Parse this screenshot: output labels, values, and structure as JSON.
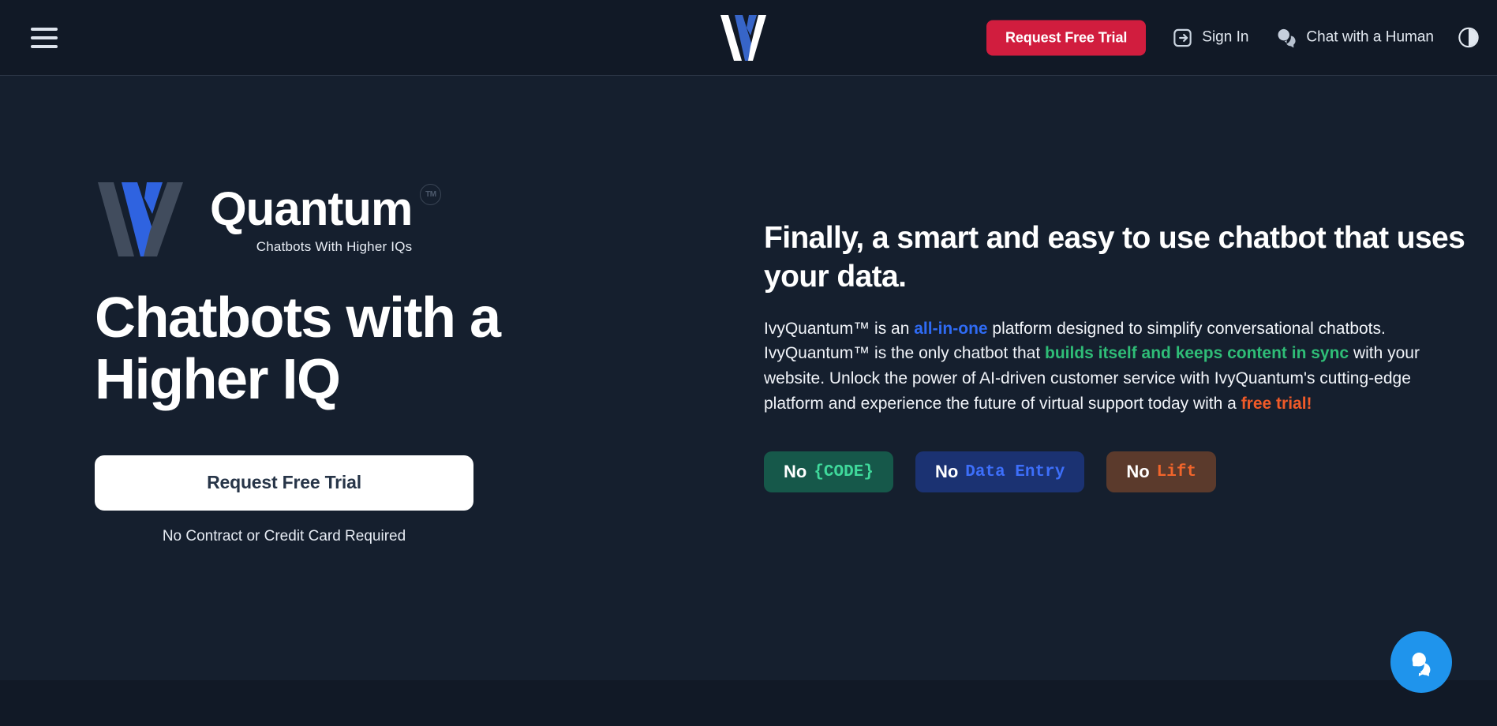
{
  "navbar": {
    "menu_icon": "hamburger-menu-icon",
    "logo_alt": "IvyQuantum logo",
    "cta_label": "Request Free Trial",
    "signin_label": "Sign In",
    "signin_icon": "login-arrow-icon",
    "chat_label": "Chat with a Human",
    "chat_icon": "speech-bubbles-icon",
    "theme_toggle_icon": "contrast-circle-icon"
  },
  "hero": {
    "brand": {
      "mark_alt": "IvyQuantum mark",
      "name": "Quantum",
      "tagline": "Chatbots With Higher IQs",
      "trademark": "TM"
    },
    "title": "Chatbots with a Higher IQ",
    "cta_label": "Request Free Trial",
    "cta_note": "No Contract or Credit Card Required"
  },
  "promo": {
    "heading": "Finally, a smart and easy to use chatbot that uses your data.",
    "body": {
      "part1": "IvyQuantum™ is an ",
      "highlight1": "all-in-one",
      "part2": " platform designed to simplify conversational chatbots. IvyQuantum™ is the only chatbot that ",
      "highlight2": "builds itself and keeps content in sync",
      "part3": " with your website. Unlock the power of AI-driven customer service with IvyQuantum's cutting-edge platform and experience the future of virtual support today with a ",
      "highlight3": "free trial!"
    },
    "badges": [
      {
        "prefix": "No",
        "value": "{CODE}"
      },
      {
        "prefix": "No",
        "value": "Data Entry"
      },
      {
        "prefix": "No",
        "value": "Lift"
      }
    ]
  },
  "chat_widget": {
    "icon": "speech-bubbles-icon",
    "color": "#1f94ec"
  },
  "colors": {
    "navbar_bg": "#111926",
    "hero_bg": "#151f2e",
    "cta_red": "#d11d3e",
    "accent_blue": "#2f6bf4",
    "accent_green": "#2fbd77",
    "accent_orange": "#f05a28",
    "badge_code_bg": "#16584a",
    "badge_data_bg": "#1b3272",
    "badge_lift_bg": "#5b3a2c",
    "chat_blue": "#1f94ec"
  }
}
